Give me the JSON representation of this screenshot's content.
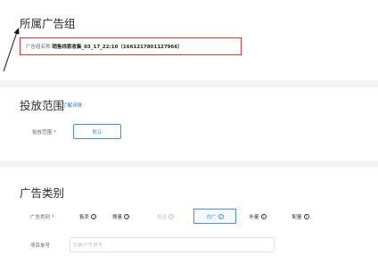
{
  "ad_group": {
    "title": "所属广告组",
    "name_label": "广告组名称:",
    "name_value": "销售线索收集_03_17_22:10（1661217801127966）"
  },
  "placement": {
    "title": "投放范围",
    "learn_more_link": "了解详情",
    "field_label": "投放范围",
    "required_mark": "*",
    "default_button": "默认"
  },
  "ad_type": {
    "title": "广告类别",
    "field_label": "广告类别",
    "required_mark": "*",
    "options": [
      {
        "label": "售卖",
        "state": "normal"
      },
      {
        "label": "换量",
        "state": "normal"
      },
      {
        "label": "配送",
        "state": "disabled"
      },
      {
        "label": "内广",
        "state": "selected"
      },
      {
        "label": "补量",
        "state": "normal"
      },
      {
        "label": "配量",
        "state": "normal"
      }
    ],
    "help_icon": "question-circle-icon"
  },
  "project": {
    "field_label": "项目单号",
    "input_placeholder": "仅能小写填写",
    "input_value": ""
  },
  "colors": {
    "accent": "#4a90e2",
    "highlight_box": "#e53935",
    "divider": "#f2f3f5"
  }
}
